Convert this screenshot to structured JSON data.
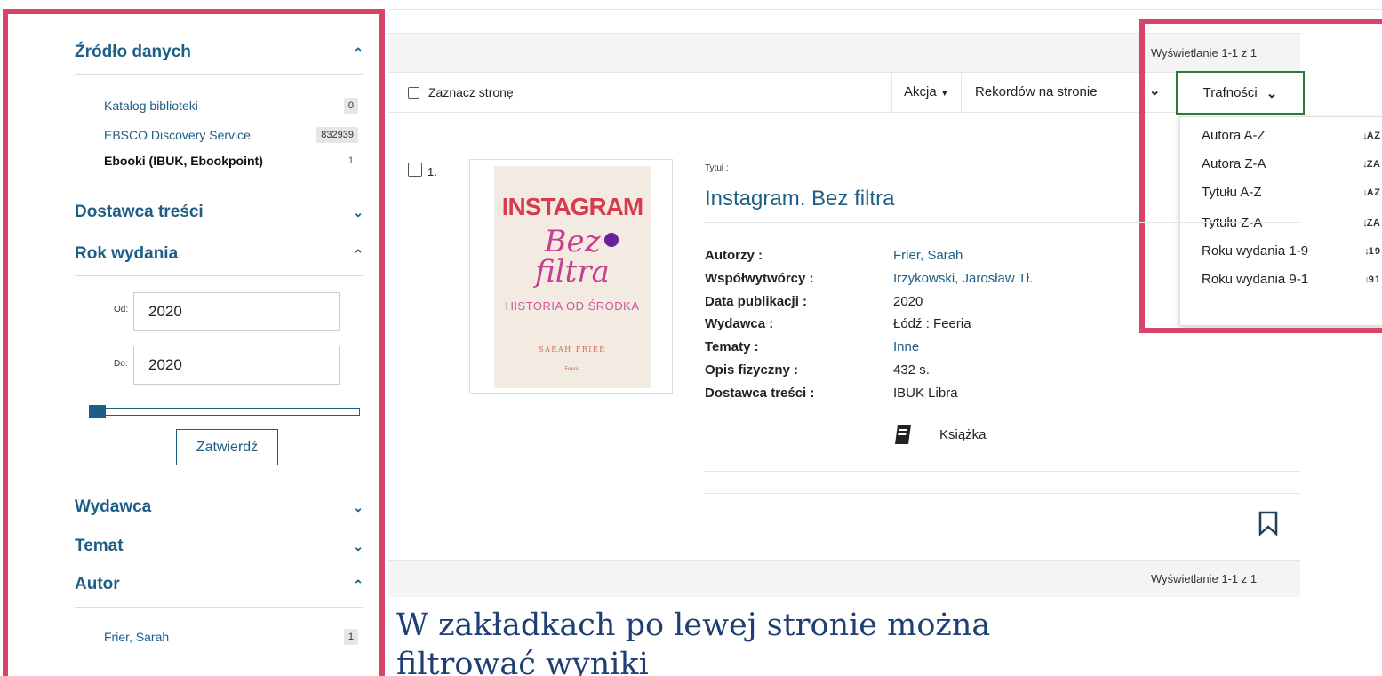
{
  "sidebar": {
    "source": {
      "title": "Źródło danych",
      "items": [
        {
          "label": "Katalog biblioteki",
          "count": "0"
        },
        {
          "label": "EBSCO Discovery Service",
          "count": "832939"
        },
        {
          "label": "Ebooki (IBUK, Ebookpoint)",
          "count": "1"
        }
      ]
    },
    "provider": {
      "title": "Dostawca treści"
    },
    "year": {
      "title": "Rok wydania",
      "from_label": "Od:",
      "from_value": "2020",
      "to_label": "Do:",
      "to_value": "2020",
      "apply_label": "Zatwierdź"
    },
    "publisher": {
      "title": "Wydawca"
    },
    "subject": {
      "title": "Temat"
    },
    "author": {
      "title": "Autor",
      "items": [
        {
          "label": "Frier, Sarah",
          "count": "1"
        }
      ]
    }
  },
  "toolbar": {
    "showing_top": "Wyświetlanie 1-1 z 1",
    "select_page": "Zaznacz stronę",
    "action": "Akcja",
    "records_per_page": "Rekordów na stronie",
    "sort_selected": "Trafności",
    "sort_options": [
      {
        "label": "Autora A-Z",
        "icon": "↓A Z"
      },
      {
        "label": "Autora Z-A",
        "icon": "↓Z A"
      },
      {
        "label": "Tytułu A-Z",
        "icon": "↓A Z"
      },
      {
        "label": "Tytułu Z-A",
        "icon": "↓Z A"
      },
      {
        "label": "Roku wydania 1-9",
        "icon": "↓1 9"
      },
      {
        "label": "Roku wydania 9-1",
        "icon": "↓9 1"
      }
    ]
  },
  "result": {
    "number": "1.",
    "title_label": "Tytuł :",
    "title": "Instagram. Bez filtra",
    "cover": {
      "line1": "INSTAGRAM",
      "line2": "Bez",
      "line3": "filtra",
      "subtitle": "HISTORIA OD ŚRODKA",
      "author": "SARAH FRIER",
      "publisher": "Feeria"
    },
    "meta": [
      {
        "label": "Autorzy :",
        "value": "Frier, Sarah",
        "link": true
      },
      {
        "label": "Współwytwórcy :",
        "value": "Irzykowski, Jarosław Tł.",
        "link": true
      },
      {
        "label": "Data publikacji :",
        "value": "2020",
        "link": false
      },
      {
        "label": "Wydawca :",
        "value": "Łódź : Feeria",
        "link": false
      },
      {
        "label": "Tematy :",
        "value": "Inne",
        "link": true
      },
      {
        "label": "Opis fizyczny :",
        "value": "432 s.",
        "link": false
      },
      {
        "label": "Dostawca treści :",
        "value": "IBUK Libra",
        "link": false
      }
    ],
    "format": "Książka"
  },
  "footer": {
    "showing_bottom": "Wyświetlanie 1-1 z 1"
  },
  "caption": {
    "line1": "W zakładkach po lewej stronie można",
    "line2": "filtrować wyniki"
  },
  "colors": {
    "highlight_frame": "#d9456a",
    "link": "#1e5d86",
    "sort_border": "#2d7a34"
  },
  "icons": {
    "book": "book-icon",
    "bookmark": "bookmark-icon",
    "chevron_up": "chevron-up-icon",
    "chevron_down": "chevron-down-icon"
  }
}
